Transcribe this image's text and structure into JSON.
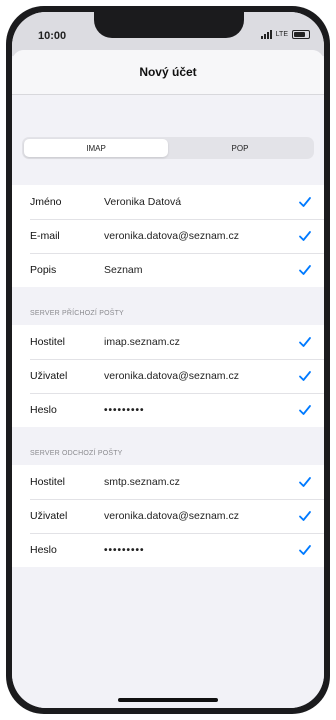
{
  "status_bar": {
    "time": "10:00",
    "network": "LTE"
  },
  "navbar": {
    "title": "Nový účet"
  },
  "segmented": {
    "options": [
      {
        "label": "IMAP",
        "selected": true
      },
      {
        "label": "POP",
        "selected": false
      }
    ]
  },
  "account": {
    "rows": [
      {
        "label": "Jméno",
        "value": "Veronika Datová"
      },
      {
        "label": "E-mail",
        "value": "veronika.datova@seznam.cz"
      },
      {
        "label": "Popis",
        "value": "Seznam"
      }
    ]
  },
  "incoming": {
    "header": "SERVER PŘÍCHOZÍ POŠTY",
    "rows": [
      {
        "label": "Hostitel",
        "value": "imap.seznam.cz"
      },
      {
        "label": "Uživatel",
        "value": "veronika.datova@seznam.cz"
      },
      {
        "label": "Heslo",
        "value": "•••••••••"
      }
    ]
  },
  "outgoing": {
    "header": "SERVER ODCHOZÍ POŠTY",
    "rows": [
      {
        "label": "Hostitel",
        "value": "smtp.seznam.cz"
      },
      {
        "label": "Uživatel",
        "value": "veronika.datova@seznam.cz"
      },
      {
        "label": "Heslo",
        "value": "•••••••••"
      }
    ]
  },
  "colors": {
    "accent": "#007aff",
    "background": "#f2f2f7"
  },
  "icons": {
    "row_check": "checkmark-icon"
  }
}
